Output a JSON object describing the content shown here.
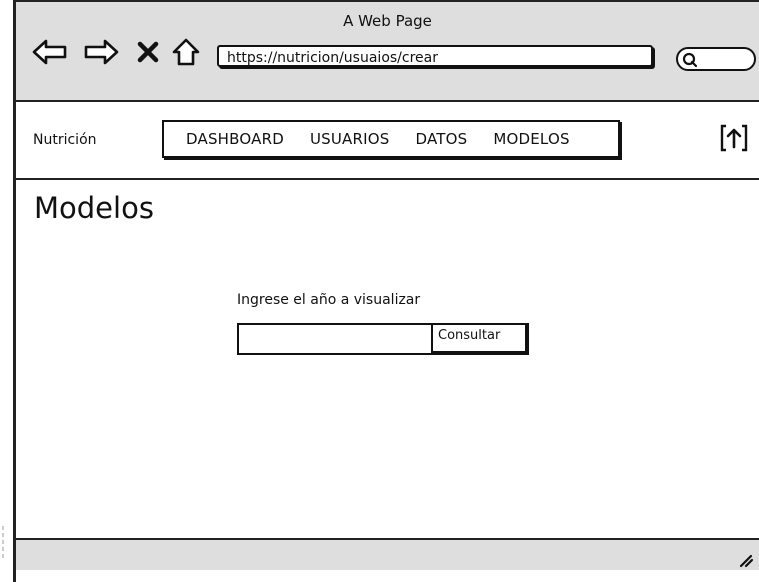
{
  "window": {
    "title": "A Web Page",
    "address": "https://nutricion/usuaios/crear"
  },
  "browser_controls": {
    "back_icon": "arrow-left-outline",
    "forward_icon": "arrow-right-outline",
    "close_icon": "x-mark",
    "home_icon": "house-outline",
    "search_icon": "magnifier"
  },
  "appbar": {
    "brand": "Nutrición",
    "menu": [
      {
        "label": "DASHBOARD"
      },
      {
        "label": "USUARIOS"
      },
      {
        "label": "DATOS"
      },
      {
        "label": "MODELOS"
      }
    ],
    "upload_icon": "upload-arrow"
  },
  "main": {
    "title": "Modelos",
    "prompt": "Ingrese el año a visualizar",
    "year_value": "",
    "button_label": "Consultar"
  },
  "colors": {
    "chrome_gray": "#dedede",
    "ink": "#111111",
    "background": "#ffffff"
  }
}
